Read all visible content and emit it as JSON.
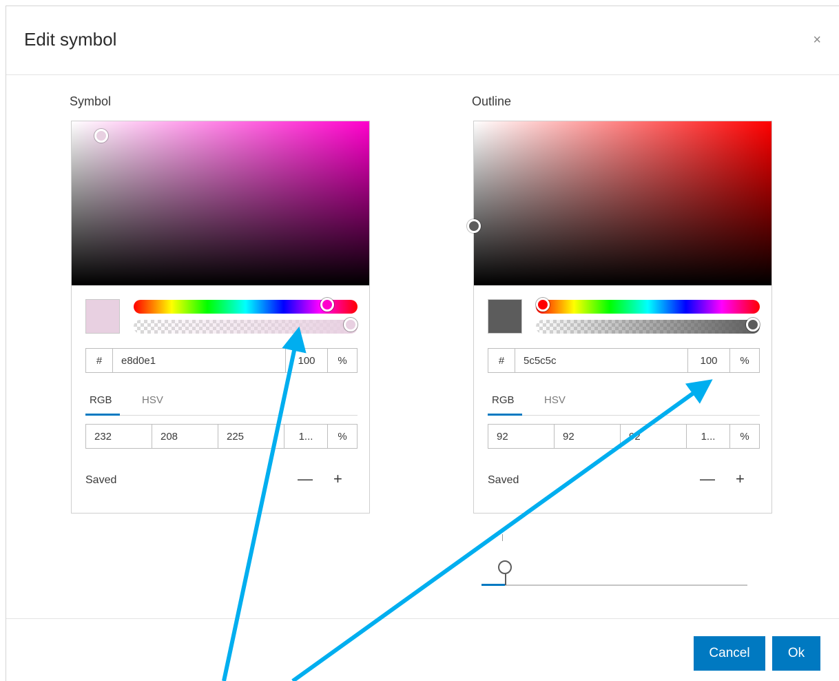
{
  "dialog": {
    "title": "Edit symbol",
    "close_icon": "×",
    "cancel_label": "Cancel",
    "ok_label": "Ok"
  },
  "symbol": {
    "label": "Symbol",
    "hex": "e8d0e1",
    "hash": "#",
    "alpha": "100",
    "pct": "%",
    "tabs": [
      "RGB",
      "HSV"
    ],
    "rgb": [
      "232",
      "208",
      "225"
    ],
    "rgb_alpha": "1...",
    "saved_label": "Saved",
    "minus": "—",
    "plus": "+",
    "hue_color": "#ff00cc",
    "swatch_color": "#e8d0e1",
    "saturation": 0.1,
    "value": 0.91,
    "hue_position": 0.89,
    "alpha_position": 1.0
  },
  "outline": {
    "label": "Outline",
    "hex": "5c5c5c",
    "hash": "#",
    "alpha": "100",
    "pct": "%",
    "tabs": [
      "RGB",
      "HSV"
    ],
    "rgb": [
      "92",
      "92",
      "92"
    ],
    "rgb_alpha": "1...",
    "saved_label": "Saved",
    "minus": "—",
    "plus": "+",
    "hue_color": "#ff0000",
    "swatch_color": "#5c5c5c",
    "saturation": 0.0,
    "value": 0.36,
    "hue_position": 0.0,
    "alpha_position": 1.0
  },
  "annotation": {
    "arrow_color": "#00aeef"
  }
}
